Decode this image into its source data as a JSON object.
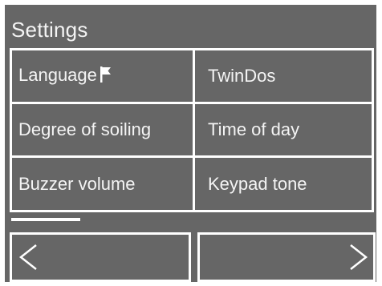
{
  "header": {
    "title": "Settings"
  },
  "menu": {
    "items": [
      {
        "label": "Language",
        "icon": "flag-icon"
      },
      {
        "label": "TwinDos"
      },
      {
        "label": "Degree of soiling"
      },
      {
        "label": "Time of day"
      },
      {
        "label": "Buzzer volume"
      },
      {
        "label": "Keypad tone"
      }
    ]
  },
  "pagination": {
    "progress_fraction": 0.19
  },
  "navigation": {
    "prev_icon": "chevron-left-icon",
    "next_icon": "chevron-right-icon"
  },
  "colors": {
    "background": "#666666",
    "foreground": "#ffffff"
  }
}
